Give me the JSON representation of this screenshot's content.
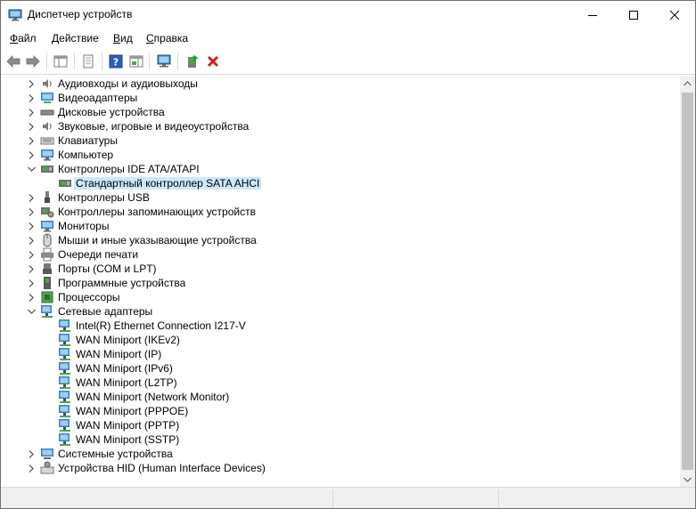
{
  "window": {
    "title": "Диспетчер устройств"
  },
  "menu": [
    {
      "pre": "",
      "key": "Ф",
      "post": "айл"
    },
    {
      "pre": "",
      "key": "Д",
      "post": "ействие"
    },
    {
      "pre": "",
      "key": "В",
      "post": "ид"
    },
    {
      "pre": "",
      "key": "С",
      "post": "правка"
    }
  ],
  "toolbar": {
    "buttons": [
      "back-icon",
      "forward-icon",
      "show-hide-tree-icon",
      "properties-icon",
      "help-icon",
      "action-pane-icon",
      "scan-hardware-icon",
      "update-driver-icon",
      "uninstall-icon"
    ]
  },
  "tree": [
    {
      "label": "Аудиовходы и аудиовыходы",
      "level": 0,
      "expanded": false,
      "icon": "audio-io-icon"
    },
    {
      "label": "Видеоадаптеры",
      "level": 0,
      "expanded": false,
      "icon": "display-adapter-icon"
    },
    {
      "label": "Дисковые устройства",
      "level": 0,
      "expanded": false,
      "icon": "disk-drive-icon"
    },
    {
      "label": "Звуковые, игровые и видеоустройства",
      "level": 0,
      "expanded": false,
      "icon": "sound-icon"
    },
    {
      "label": "Клавиатуры",
      "level": 0,
      "expanded": false,
      "icon": "keyboard-icon"
    },
    {
      "label": "Компьютер",
      "level": 0,
      "expanded": false,
      "icon": "computer-icon"
    },
    {
      "label": "Контроллеры IDE ATA/ATAPI",
      "level": 0,
      "expanded": true,
      "icon": "ide-controller-icon"
    },
    {
      "label": "Стандартный контроллер SATA AHCI",
      "level": 1,
      "selected": true,
      "icon": "ide-controller-icon"
    },
    {
      "label": "Контроллеры USB",
      "level": 0,
      "expanded": false,
      "icon": "usb-icon"
    },
    {
      "label": "Контроллеры запоминающих устройств",
      "level": 0,
      "expanded": false,
      "icon": "storage-controller-icon"
    },
    {
      "label": "Мониторы",
      "level": 0,
      "expanded": false,
      "icon": "monitor-icon"
    },
    {
      "label": "Мыши и иные указывающие устройства",
      "level": 0,
      "expanded": false,
      "icon": "mouse-icon"
    },
    {
      "label": "Очереди печати",
      "level": 0,
      "expanded": false,
      "icon": "printer-icon"
    },
    {
      "label": "Порты (COM и LPT)",
      "level": 0,
      "expanded": false,
      "icon": "port-icon"
    },
    {
      "label": "Программные устройства",
      "level": 0,
      "expanded": false,
      "icon": "software-device-icon"
    },
    {
      "label": "Процессоры",
      "level": 0,
      "expanded": false,
      "icon": "processor-icon"
    },
    {
      "label": "Сетевые адаптеры",
      "level": 0,
      "expanded": true,
      "icon": "network-adapter-icon"
    },
    {
      "label": "Intel(R) Ethernet Connection I217-V",
      "level": 1,
      "icon": "network-adapter-icon"
    },
    {
      "label": "WAN Miniport (IKEv2)",
      "level": 1,
      "icon": "network-adapter-icon"
    },
    {
      "label": "WAN Miniport (IP)",
      "level": 1,
      "icon": "network-adapter-icon"
    },
    {
      "label": "WAN Miniport (IPv6)",
      "level": 1,
      "icon": "network-adapter-icon"
    },
    {
      "label": "WAN Miniport (L2TP)",
      "level": 1,
      "icon": "network-adapter-icon"
    },
    {
      "label": "WAN Miniport (Network Monitor)",
      "level": 1,
      "icon": "network-adapter-icon"
    },
    {
      "label": "WAN Miniport (PPPOE)",
      "level": 1,
      "icon": "network-adapter-icon"
    },
    {
      "label": "WAN Miniport (PPTP)",
      "level": 1,
      "icon": "network-adapter-icon"
    },
    {
      "label": "WAN Miniport (SSTP)",
      "level": 1,
      "icon": "network-adapter-icon"
    },
    {
      "label": "Системные устройства",
      "level": 0,
      "expanded": false,
      "icon": "system-device-icon"
    },
    {
      "label": "Устройства HID (Human Interface Devices)",
      "level": 0,
      "expanded": false,
      "icon": "hid-icon"
    }
  ]
}
